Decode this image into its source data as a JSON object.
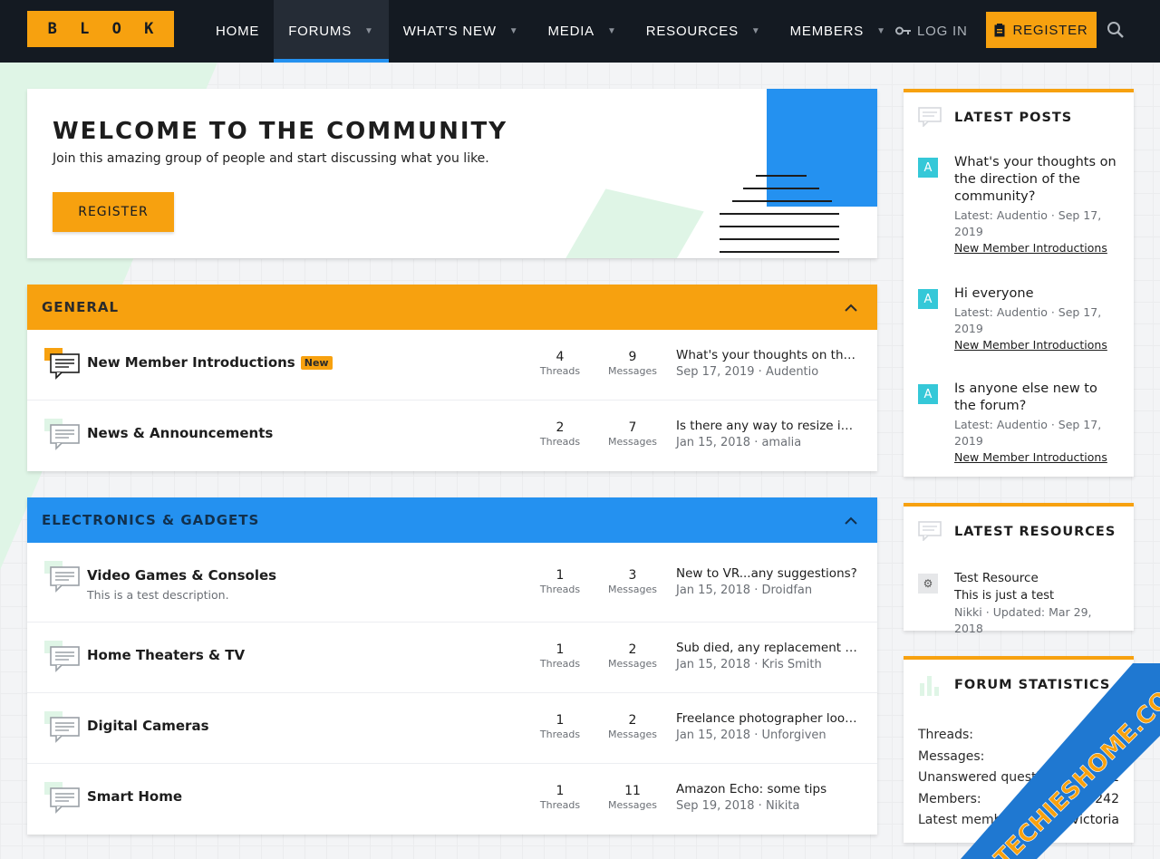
{
  "header": {
    "logo_letters": [
      "B",
      "L",
      "O",
      "K"
    ],
    "nav": [
      {
        "label": "Home",
        "caret": false,
        "active": false
      },
      {
        "label": "Forums",
        "caret": true,
        "active": true
      },
      {
        "label": "What's new",
        "caret": true,
        "active": false
      },
      {
        "label": "Media",
        "caret": true,
        "active": false
      },
      {
        "label": "Resources",
        "caret": true,
        "active": false
      },
      {
        "label": "Members",
        "caret": true,
        "active": false
      }
    ],
    "login_label": "LOG IN",
    "register_label": "REGISTER"
  },
  "welcome": {
    "title": "WELCOME TO THE COMMUNITY",
    "subtitle": "Join this amazing group of people and start discussing what you like.",
    "register_label": "REGISTER"
  },
  "categories": [
    {
      "title": "GENERAL",
      "forums": [
        {
          "title": "New Member Introductions",
          "badge": "New",
          "description": "",
          "threads": "4",
          "messages": "9",
          "last_title": "What's your thoughts on the direction of the community?",
          "last_date": "Sep 17, 2019",
          "last_user": "Audentio",
          "unread": true
        },
        {
          "title": "News & Announcements",
          "badge": "",
          "description": "",
          "threads": "2",
          "messages": "7",
          "last_title": "Is there any way to resize images?",
          "last_date": "Jan 15, 2018",
          "last_user": "amalia",
          "unread": false
        }
      ]
    },
    {
      "title": "ELECTRONICS & GADGETS",
      "forums": [
        {
          "title": "Video Games & Consoles",
          "badge": "",
          "description": "This is a test description.",
          "threads": "1",
          "messages": "3",
          "last_title": "New to VR...any suggestions?",
          "last_date": "Jan 15, 2018",
          "last_user": "Droidfan",
          "unread": false
        },
        {
          "title": "Home Theaters & TV",
          "badge": "",
          "description": "",
          "threads": "1",
          "messages": "2",
          "last_title": "Sub died, any replacement suggestions?",
          "last_date": "Jan 15, 2018",
          "last_user": "Kris Smith",
          "unread": false
        },
        {
          "title": "Digital Cameras",
          "badge": "",
          "description": "",
          "threads": "1",
          "messages": "2",
          "last_title": "Freelance photographer looking for tips",
          "last_date": "Jan 15, 2018",
          "last_user": "Unforgiven",
          "unread": false
        },
        {
          "title": "Smart Home",
          "badge": "",
          "description": "",
          "threads": "1",
          "messages": "11",
          "last_title": "Amazon Echo: some tips",
          "last_date": "Sep 19, 2018",
          "last_user": "Nikita",
          "unread": false
        }
      ]
    }
  ],
  "labels": {
    "threads": "Threads",
    "messages": "Messages"
  },
  "sidebar": {
    "latest_posts": {
      "title": "LATEST POSTS",
      "items": [
        {
          "avatar": "A",
          "title": "What's your thoughts on the direction of the community?",
          "meta": "Latest: Audentio · Sep 17, 2019",
          "forum": "New Member Introductions"
        },
        {
          "avatar": "A",
          "title": "Hi everyone",
          "meta": "Latest: Audentio · Sep 17, 2019",
          "forum": "New Member Introductions"
        },
        {
          "avatar": "A",
          "title": "Is anyone else new to the forum?",
          "meta": "Latest: Audentio · Sep 17, 2019",
          "forum": "New Member Introductions"
        }
      ]
    },
    "latest_resources": {
      "title": "LATEST RESOURCES",
      "items": [
        {
          "title": "Test Resource",
          "tagline": "This is just a test",
          "meta": "Nikki · Updated: Mar 29, 2018"
        }
      ]
    },
    "forum_statistics": {
      "title": "FORUM STATISTICS",
      "rows": [
        {
          "label": "Threads:",
          "value": ""
        },
        {
          "label": "Messages:",
          "value": ""
        },
        {
          "label": "Unanswered questions:",
          "value": "1"
        },
        {
          "label": "Members:",
          "value": "242"
        },
        {
          "label": "Latest member:",
          "value": "Victoria"
        }
      ]
    }
  },
  "watermark": {
    "text": "TECHIESHOME.COM"
  },
  "colors": {
    "accent_orange": "#f7a10f",
    "accent_blue": "#2491f0",
    "header_bg": "#141a22"
  }
}
